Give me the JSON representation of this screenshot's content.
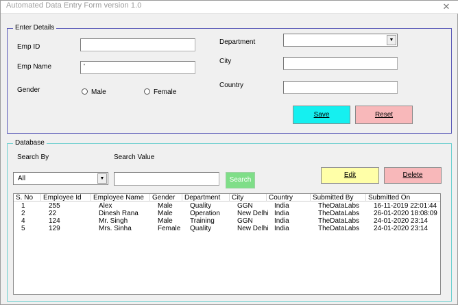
{
  "window": {
    "title": "Automated Data Entry Form version 1.0",
    "close_glyph": "✕"
  },
  "details": {
    "legend": "Enter Details",
    "emp_id_label": "Emp ID",
    "emp_id_value": "",
    "emp_name_label": "Emp Name",
    "emp_name_value": "'",
    "gender_label": "Gender",
    "gender_options": [
      "Male",
      "Female"
    ],
    "department_label": "Department",
    "department_value": "",
    "city_label": "City",
    "city_value": "",
    "country_label": "Country",
    "country_value": "",
    "save_label": "Save",
    "reset_label": "Reset"
  },
  "database": {
    "legend": "Database",
    "search_by_label": "Search By",
    "search_by_value": "All",
    "search_value_label": "Search Value",
    "search_value": "",
    "search_label": "Search",
    "edit_label": "Edit",
    "delete_label": "Delete",
    "columns": [
      "S. No",
      "Employee Id",
      "Employee Name",
      "Gender",
      "Department",
      "City",
      "Country",
      "Submitted By",
      "Submitted On"
    ],
    "rows": [
      [
        "1",
        "255",
        "Alex",
        "Male",
        "Quality",
        "GGN",
        "India",
        "TheDataLabs",
        "16-11-2019 22:01:44"
      ],
      [
        "2",
        "22",
        "Dinesh Rana",
        "Male",
        "Operation",
        "New Delhi",
        "India",
        "TheDataLabs",
        "26-01-2020 18:08:09"
      ],
      [
        "4",
        "124",
        "Mr. Singh",
        "Male",
        "Training",
        "GGN",
        "India",
        "TheDataLabs",
        "24-01-2020 23:14"
      ],
      [
        "5",
        "129",
        "Mrs. Sinha",
        "Female",
        "Quality",
        "New Delhi",
        "India",
        "TheDataLabs",
        "24-01-2020 23:14"
      ]
    ]
  },
  "icons": {
    "dropdown": "▼"
  },
  "colors": {
    "details_border": "#5b5bb8",
    "database_border": "#6ccfcf",
    "save_button": "#15f0f0",
    "reset_button": "#f8b8ba",
    "search_button": "#7fde88",
    "edit_button": "#ffffa8",
    "delete_button": "#f8b8ba"
  }
}
